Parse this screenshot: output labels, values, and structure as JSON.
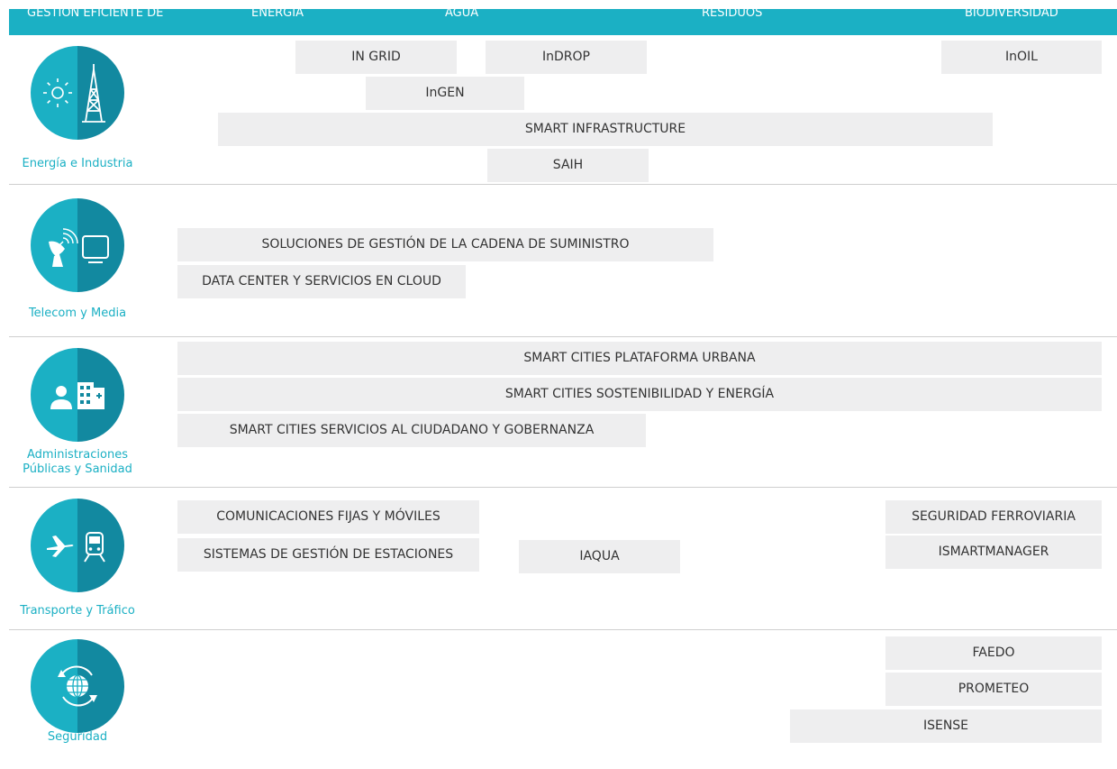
{
  "header": {
    "labels": [
      "GESTIÓN EFICIENTE DE",
      "ENERGÍA",
      "AGUA",
      "RESIDUOS",
      "BIODIVERSIDAD"
    ]
  },
  "colors": {
    "accent": "#1bb0c4",
    "accent_dark": "#1289a0",
    "box_bg": "#eeeeef",
    "box_text": "#333333"
  },
  "sectors": [
    {
      "label": "Energía e Industria",
      "icon": "sun-and-oil-derrick-icon",
      "solutions": [
        "IN GRID",
        "InDROP",
        "InOIL",
        "InGEN",
        "SMART INFRASTRUCTURE",
        "SAIH"
      ]
    },
    {
      "label": "Telecom y Media",
      "icon": "satellite-dish-and-screen-icon",
      "solutions": [
        "SOLUCIONES DE GESTIÓN DE LA CADENA DE SUMINISTRO",
        "DATA CENTER Y SERVICIOS EN CLOUD"
      ]
    },
    {
      "label_lines": [
        "Administraciones",
        "Públicas y Sanidad"
      ],
      "icon": "doctor-and-hospital-icon",
      "solutions": [
        "SMART CITIES PLATAFORMA URBANA",
        "SMART CITIES SOSTENIBILIDAD Y ENERGÍA",
        "SMART CITIES SERVICIOS AL CIUDADANO Y GOBERNANZA"
      ]
    },
    {
      "label": "Transporte y Tráfico",
      "icon": "airplane-and-train-icon",
      "solutions": [
        "COMUNICACIONES FIJAS Y MÓVILES",
        "SEGURIDAD FERROVIARIA",
        "SISTEMAS DE GESTIÓN DE ESTACIONES",
        "IAQUA",
        "ISMARTMANAGER"
      ]
    },
    {
      "label": "Seguridad",
      "icon": "globe-arrows-icon",
      "solutions": [
        "FAEDO",
        "PROMETEO",
        "ISENSE"
      ]
    }
  ]
}
